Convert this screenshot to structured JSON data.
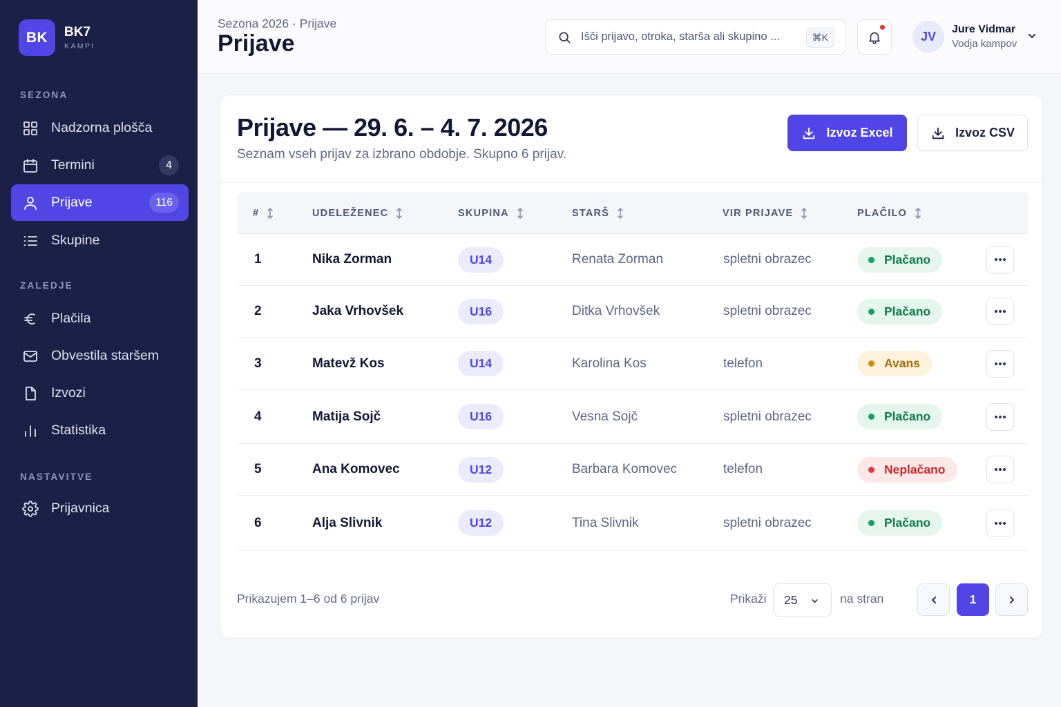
{
  "brand": {
    "logo": "BK",
    "name": "BK7",
    "sub": "KAMPI"
  },
  "sidebar": {
    "sections": [
      {
        "label": "SEZONA"
      },
      {
        "label": "ZALEDJE"
      },
      {
        "label": "NASTAVITVE"
      }
    ],
    "items": [
      {
        "label": "Nadzorna plošča",
        "icon": "dashboard-icon"
      },
      {
        "label": "Termini",
        "icon": "calendar-icon",
        "badge": "4"
      },
      {
        "label": "Prijave",
        "icon": "user-icon",
        "badge": "116",
        "active": true
      },
      {
        "label": "Skupine",
        "icon": "list-icon"
      },
      {
        "label": "Plačila",
        "icon": "euro-icon"
      },
      {
        "label": "Obvestila staršem",
        "icon": "mail-icon"
      },
      {
        "label": "Izvozi",
        "icon": "file-icon"
      },
      {
        "label": "Statistika",
        "icon": "bar-chart-icon"
      },
      {
        "label": "Prijavnica",
        "icon": "gear-icon"
      }
    ]
  },
  "header": {
    "breadcrumb": "Sezona 2026 · Prijave",
    "title": "Prijave",
    "search_placeholder": "Išči prijavo, otroka, starša ali skupino ...",
    "search_shortcut": "⌘K",
    "user": {
      "initials": "JV",
      "name": "Jure Vidmar",
      "role": "Vodja kampov"
    }
  },
  "card": {
    "title": "Prijave — 29. 6. – 4. 7. 2026",
    "subtitle": "Seznam vseh prijav za izbrano obdobje. Skupno 6 prijav.",
    "export_excel": "Izvoz Excel",
    "export_csv": "Izvoz CSV"
  },
  "table": {
    "columns": [
      "#",
      "UDELEŽENEC",
      "SKUPINA",
      "STARŠ",
      "VIR PRIJAVE",
      "PLAČILO"
    ],
    "rows": [
      {
        "num": "1",
        "name": "Nika Zorman",
        "group": "U14",
        "parent": "Renata Zorman",
        "source": "spletni obrazec",
        "payment": "Plačano",
        "status": "paid"
      },
      {
        "num": "2",
        "name": "Jaka Vrhovšek",
        "group": "U16",
        "parent": "Ditka Vrhovšek",
        "source": "spletni obrazec",
        "payment": "Plačano",
        "status": "paid"
      },
      {
        "num": "3",
        "name": "Matevž Kos",
        "group": "U14",
        "parent": "Karolina Kos",
        "source": "telefon",
        "payment": "Avans",
        "status": "adv"
      },
      {
        "num": "4",
        "name": "Matija Sojč",
        "group": "U16",
        "parent": "Vesna Sojč",
        "source": "spletni obrazec",
        "payment": "Plačano",
        "status": "paid"
      },
      {
        "num": "5",
        "name": "Ana Komovec",
        "group": "U12",
        "parent": "Barbara Komovec",
        "source": "telefon",
        "payment": "Neplačano",
        "status": "unpaid"
      },
      {
        "num": "6",
        "name": "Alja Slivnik",
        "group": "U12",
        "parent": "Tina Slivnik",
        "source": "spletni obrazec",
        "payment": "Plačano",
        "status": "paid"
      }
    ]
  },
  "footer": {
    "count": "Prikazujem 1–6 od 6 prijav",
    "show_label": "Prikaži",
    "per_page": "25",
    "per_page_suffix": "na stran",
    "current_page": "1"
  },
  "colors": {
    "accent": "#4f46e5",
    "sidebar_bg": "#1b2146",
    "paid": "#16a163",
    "advance": "#c9900f",
    "unpaid": "#e03b3b"
  }
}
